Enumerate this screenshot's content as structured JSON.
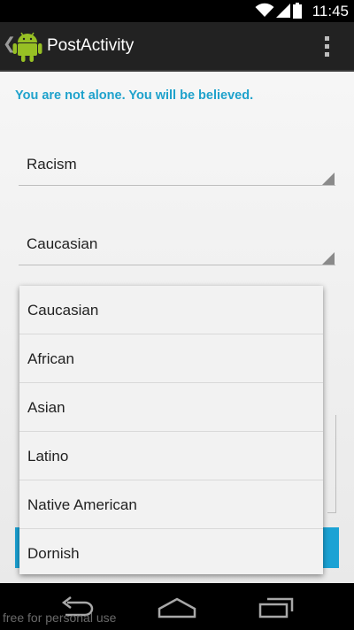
{
  "status_bar": {
    "time": "11:45"
  },
  "action_bar": {
    "title": "PostActivity"
  },
  "content": {
    "tagline": "You are not alone. You will be believed.",
    "category_spinner": {
      "value": "Racism"
    },
    "ethnicity_spinner": {
      "value": "Caucasian"
    }
  },
  "dropdown": {
    "options": [
      "Caucasian",
      "African",
      "Asian",
      "Latino",
      "Native American",
      "Dornish"
    ]
  },
  "watermark": "free for personal use",
  "colors": {
    "accent": "#1fa2cc",
    "button": "#1ba2d4",
    "action_bar": "#222222"
  }
}
